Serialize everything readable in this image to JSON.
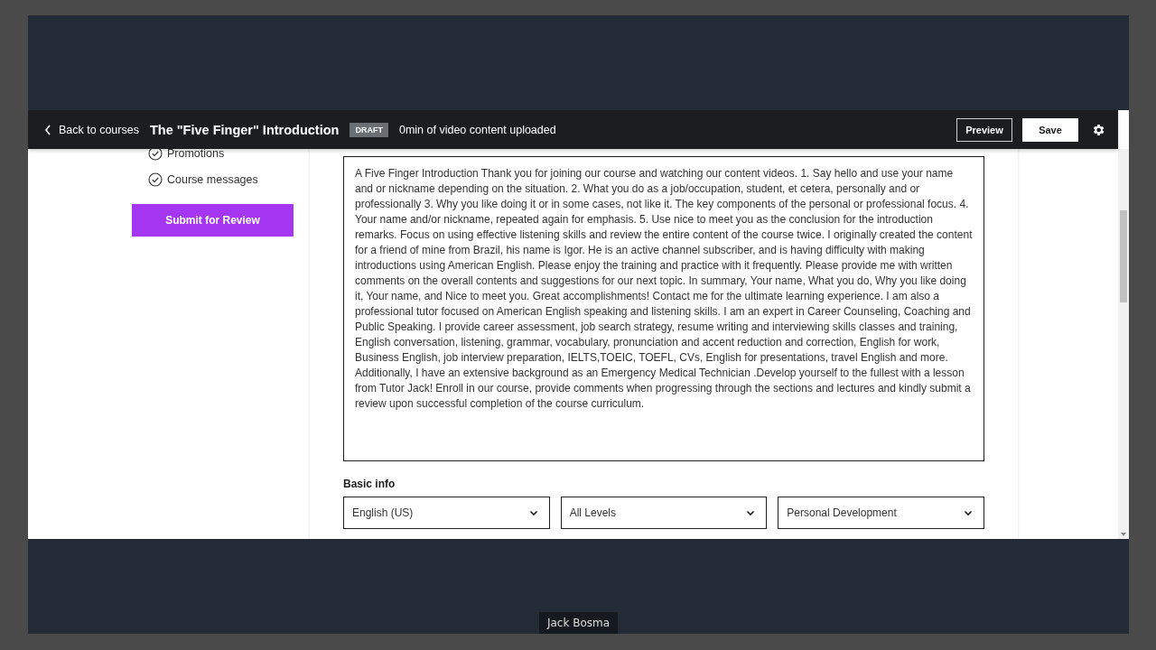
{
  "header": {
    "back_link": "Back to courses",
    "title": "The \"Five Finger\" Introduction",
    "badge": "DRAFT",
    "status": "0min of video content uploaded",
    "buttons": [
      {
        "label": "Preview",
        "kind": "outline"
      },
      {
        "label": "Save",
        "kind": "filled"
      }
    ]
  },
  "sidebar": {
    "items": [
      {
        "label": "Promotions",
        "checked": true
      },
      {
        "label": "Course messages",
        "checked": true
      }
    ],
    "submit_button": "Submit for Review"
  },
  "description": {
    "value": "A Five Finger Introduction Thank you for joining our course and watching our content videos. 1. Say hello and use your name and or nickname depending on the situation. 2. What you do as a job/occupation, student, et cetera, personally and or professionally 3. Why you like doing it or in some cases, not like it. The key components of the personal or professional focus. 4. Your name and/or nickname, repeated again for emphasis. 5. Use nice to meet you as the conclusion for the introduction remarks. Focus on using effective listening skills and review the entire content of the course twice. I originally created the content for a friend of mine from Brazil, his name is Igor. He is an active channel subscriber, and is having difficulty with making introductions using American English. Please enjoy the training and practice with it frequently. Please provide me with written comments on the overall contents and suggestions for our next topic. In summary, Your name, What you do, Why you like doing it, Your name, and Nice to meet you. Great accomplishments! Contact me for the ultimate learning experience. I am also a professional tutor focused on American English speaking and listening skills. I am an expert in Career Counseling, Coaching and Public Speaking. I provide career assessment, job search strategy, resume writing and interviewing skills classes and training, English conversation, listening, grammar, vocabulary, pronunciation and accent reduction and correction, English for work, Business English, job interview preparation, IELTS,TOEIC, TOEFL, CVs, English for presentations, travel English and more. Additionally, I have an extensive background as an Emergency Medical Technician .Develop yourself to the fullest with a lesson from Tutor Jack! Enroll in our course, provide comments when progressing through the sections and lectures and kindly submit a review upon successful completion of the course curriculum."
  },
  "basic_info": {
    "heading": "Basic info",
    "selects": [
      {
        "value": "English (US)"
      },
      {
        "value": "All Levels"
      },
      {
        "value": "Personal Development"
      }
    ]
  },
  "caption": "Jack Bosma"
}
